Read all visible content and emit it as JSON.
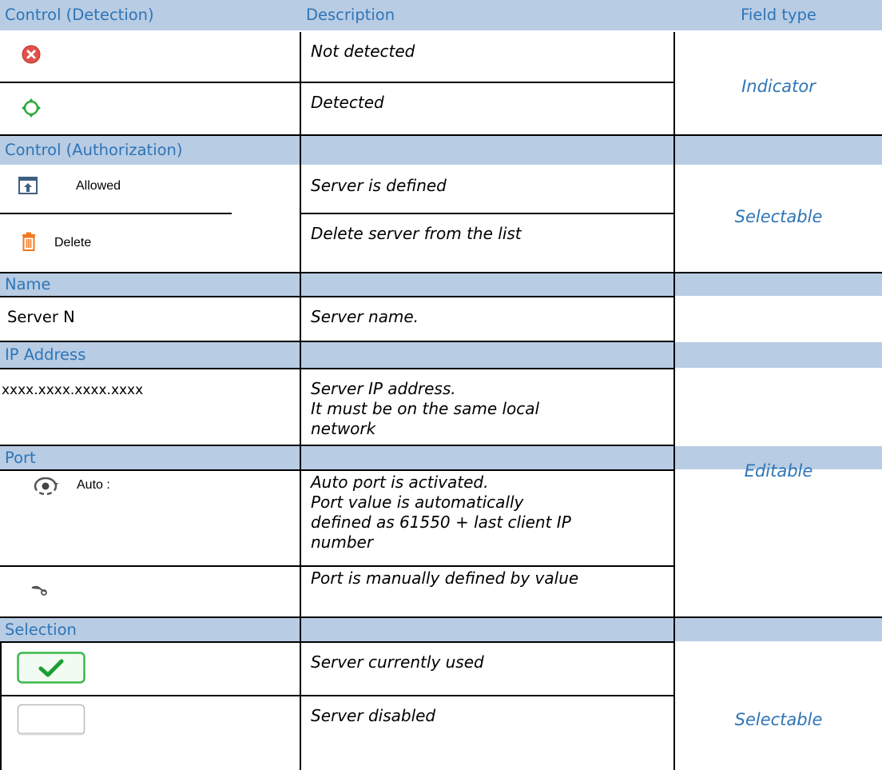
{
  "headers": {
    "control_detection": "Control (Detection)",
    "description": "Description",
    "field_type": "Field type"
  },
  "detection": {
    "rows": [
      {
        "icon": "red-x-circle-icon",
        "description": "Not detected"
      },
      {
        "icon": "green-crosshair-icon",
        "description": "Detected"
      }
    ],
    "field_type": "Indicator"
  },
  "authorization": {
    "header": "Control (Authorization)",
    "rows": [
      {
        "icon": "upload-box-icon",
        "label": "Allowed",
        "description": "Server is defined"
      },
      {
        "icon": "trash-icon",
        "label": "Delete",
        "description": "Delete server from the list"
      }
    ],
    "field_type": "Selectable"
  },
  "name": {
    "header": "Name",
    "value": "Server N",
    "description": "Server name."
  },
  "ip": {
    "header": "IP Address",
    "value": "xxxx.xxxx.xxxx.xxxx",
    "description_lines": [
      "Server IP address.",
      "It must be on the same local",
      "network"
    ]
  },
  "port": {
    "header": "Port",
    "rows": [
      {
        "icon": "auto-port-icon",
        "label": "Auto :",
        "description_lines": [
          "Auto port is activated.",
          "Port value is automatically",
          "defined as 61550 + last client IP",
          "number"
        ]
      },
      {
        "icon": "manual-port-icon",
        "description_lines": [
          "Port is manually defined by value"
        ]
      }
    ]
  },
  "editable_field_type": "Editable",
  "selection": {
    "header": "Selection",
    "rows": [
      {
        "icon": "checked-checkbox-icon",
        "description": "Server currently used"
      },
      {
        "icon": "empty-checkbox-icon",
        "description": "Server disabled"
      }
    ],
    "field_type": "Selectable"
  },
  "colors": {
    "header_bg": "#b8cce4",
    "header_text": "#2e75b6",
    "field_type_text": "#2e75b6"
  }
}
